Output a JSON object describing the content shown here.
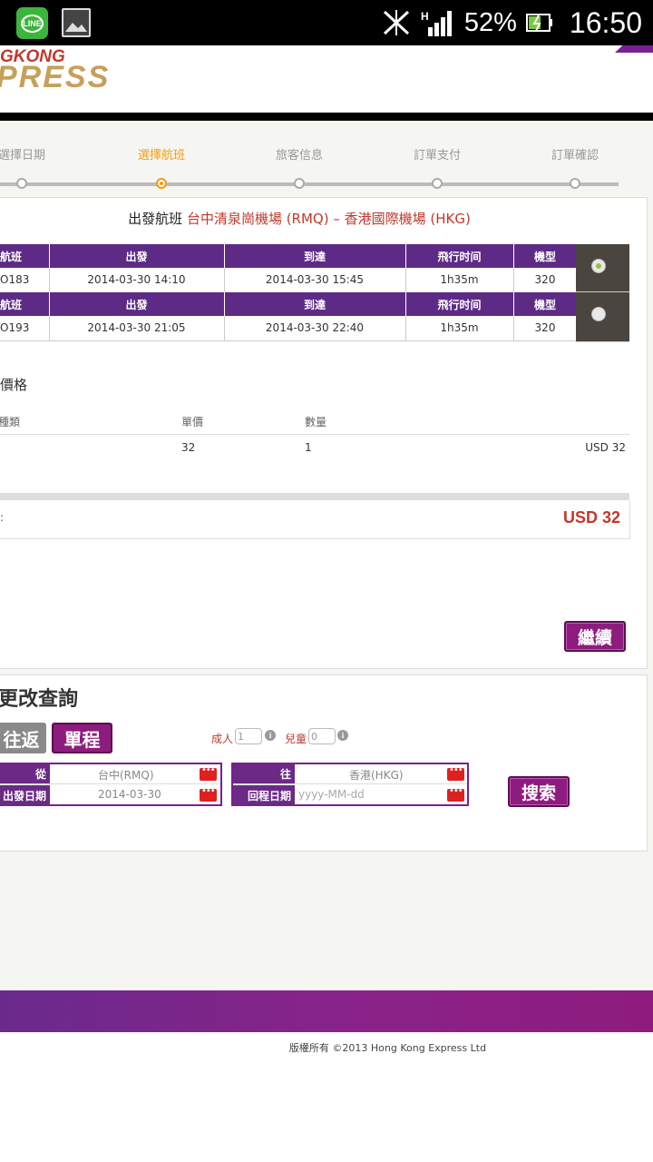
{
  "status_bar": {
    "line_app_label": "LINE",
    "battery_percent": "52%",
    "time": "16:50"
  },
  "header": {
    "logo_top": "GKONG",
    "logo_bottom": "PRESS",
    "brand_color": "#7a1f8f"
  },
  "steps": {
    "items": [
      {
        "label": "選擇日期",
        "active": false
      },
      {
        "label": "選擇航班",
        "active": true
      },
      {
        "label": "旅客信息",
        "active": false
      },
      {
        "label": "訂單支付",
        "active": false
      },
      {
        "label": "訂單確認",
        "active": false
      }
    ],
    "active_color": "#f39c12"
  },
  "flight": {
    "title_prefix": "出發航班",
    "route": "台中清泉崗機場 (RMQ) – 香港國際機場 (HKG)",
    "columns": [
      "航班",
      "出發",
      "到達",
      "飛行时间",
      "機型"
    ],
    "rows": [
      {
        "flight": "O183",
        "depart": "2014-03-30 14:10",
        "arrive": "2014-03-30 15:45",
        "duration": "1h35m",
        "aircraft": "320",
        "selected": true
      },
      {
        "flight": "O193",
        "depart": "2014-03-30 21:05",
        "arrive": "2014-03-30 22:40",
        "duration": "1h35m",
        "aircraft": "320",
        "selected": false
      }
    ]
  },
  "price": {
    "title": "價格",
    "columns": [
      "種類",
      "單價",
      "數量"
    ],
    "row": {
      "unit_price": "32",
      "quantity": "1",
      "amount": "USD 32"
    },
    "total_label": ":",
    "total_value": "USD 32"
  },
  "continue_label": "繼續",
  "search": {
    "title": "更改查詢",
    "tab_round_trip": "往返",
    "tab_one_way": "單程",
    "adults_label": "成人",
    "adults_value": "1",
    "children_label": "兒童",
    "children_value": "0",
    "info_glyph": "i",
    "from_label": "從",
    "from_value": "台中(RMQ)",
    "depart_date_label": "出發日期",
    "depart_date_value": "2014-03-30",
    "to_label": "往",
    "to_value": "香港(HKG)",
    "return_date_label": "回程日期",
    "return_date_placeholder": "yyyy-MM-dd",
    "search_label": "搜索"
  },
  "footer": {
    "copyright": "版權所有 ©2013 Hong Kong Express Ltd"
  }
}
